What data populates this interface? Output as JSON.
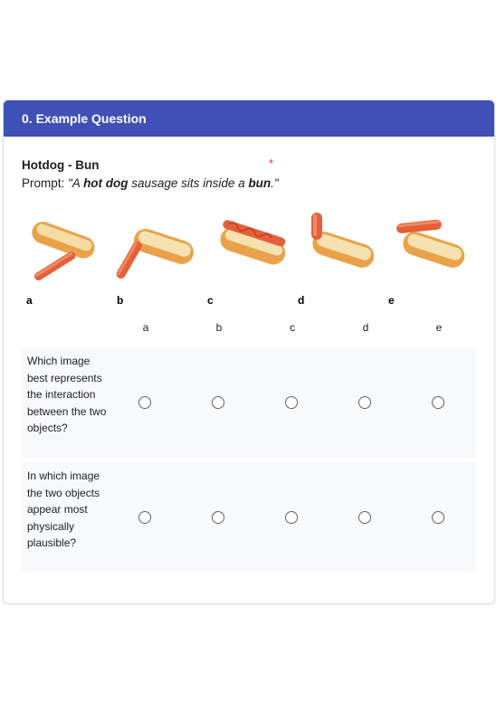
{
  "card": {
    "header": "0. Example Question",
    "question_title": "Hotdog - Bun",
    "required_mark": "*",
    "prompt": {
      "prefix": "Prompt: ",
      "parts": [
        "\"A ",
        "hot dog",
        " sausage sits inside a ",
        "bun",
        ".\""
      ]
    }
  },
  "images": [
    {
      "letter": "a"
    },
    {
      "letter": "b"
    },
    {
      "letter": "c"
    },
    {
      "letter": "d"
    },
    {
      "letter": "e"
    }
  ],
  "grid": {
    "columns": [
      "a",
      "b",
      "c",
      "d",
      "e"
    ],
    "rows": [
      {
        "label": "Which image best represents the interaction between the two objects?"
      },
      {
        "label": "In which image the two objects appear most physically plausible?"
      }
    ]
  },
  "colors": {
    "header": "#3f51b5",
    "required": "#d93025",
    "row_bg": "#f8f9fa"
  }
}
